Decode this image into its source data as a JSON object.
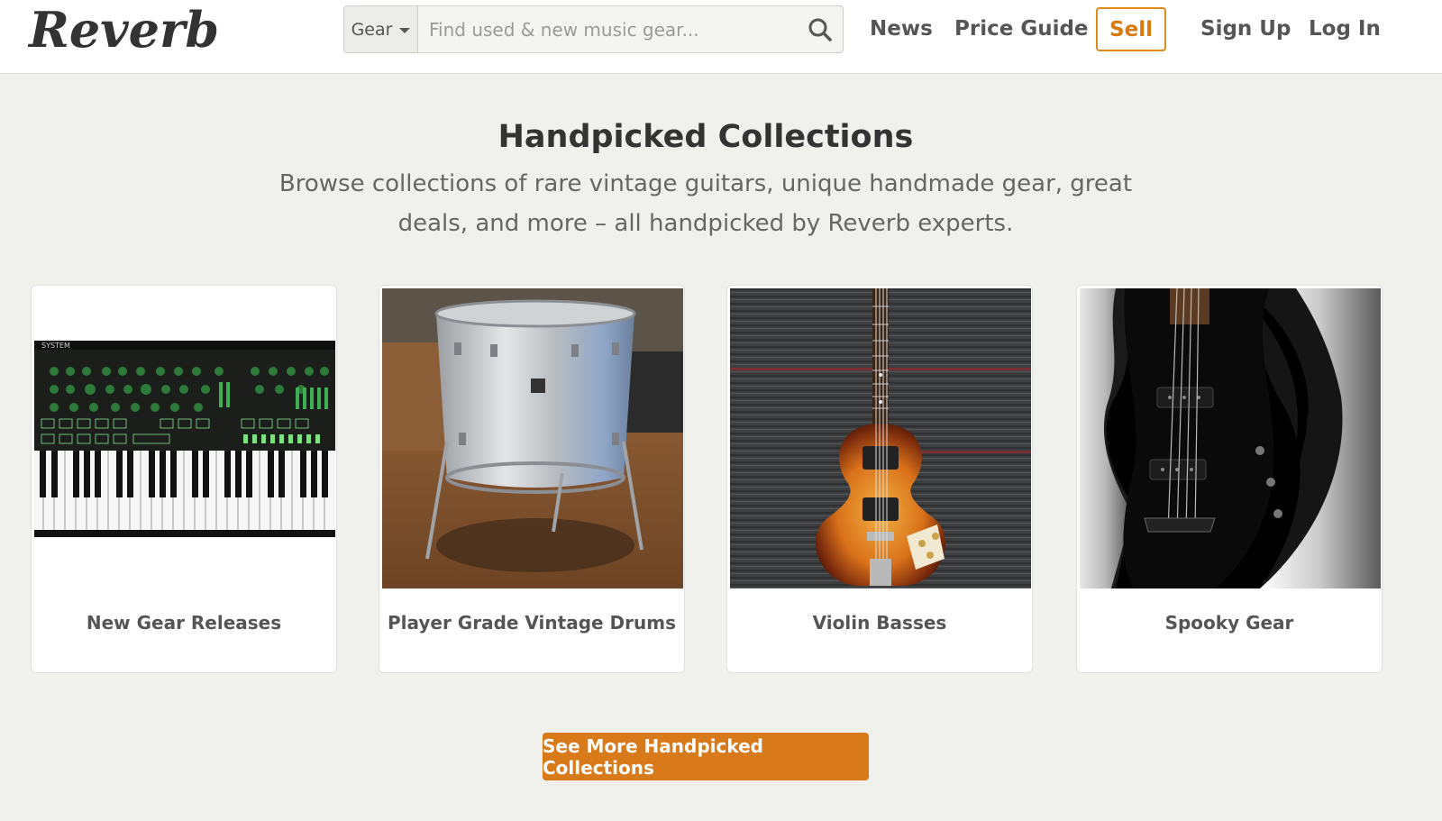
{
  "header": {
    "logo_text": "Reverb",
    "search": {
      "category": "Gear",
      "placeholder": "Find used & new music gear...",
      "button_icon": "search-icon"
    },
    "nav": {
      "news": "News",
      "price_guide": "Price Guide",
      "sell": "Sell",
      "sign_up": "Sign Up",
      "log_in": "Log In"
    }
  },
  "main": {
    "title": "Handpicked Collections",
    "description": "Browse collections of rare vintage guitars, unique handmade gear, great deals, and more – all handpicked by Reverb experts.",
    "collections": [
      {
        "label": "New Gear Releases",
        "image": "synthesizer-keyboard-image"
      },
      {
        "label": "Player Grade Vintage Drums",
        "image": "silver-floor-tom-drum-image"
      },
      {
        "label": "Violin Basses",
        "image": "violin-bass-guitar-image"
      },
      {
        "label": "Spooky Gear",
        "image": "black-axe-bass-guitar-image"
      }
    ],
    "cta_label": "See More Handpicked Collections"
  },
  "colors": {
    "accent": "#d8791a",
    "background": "#f0f0ec",
    "text_dark": "#333333"
  }
}
